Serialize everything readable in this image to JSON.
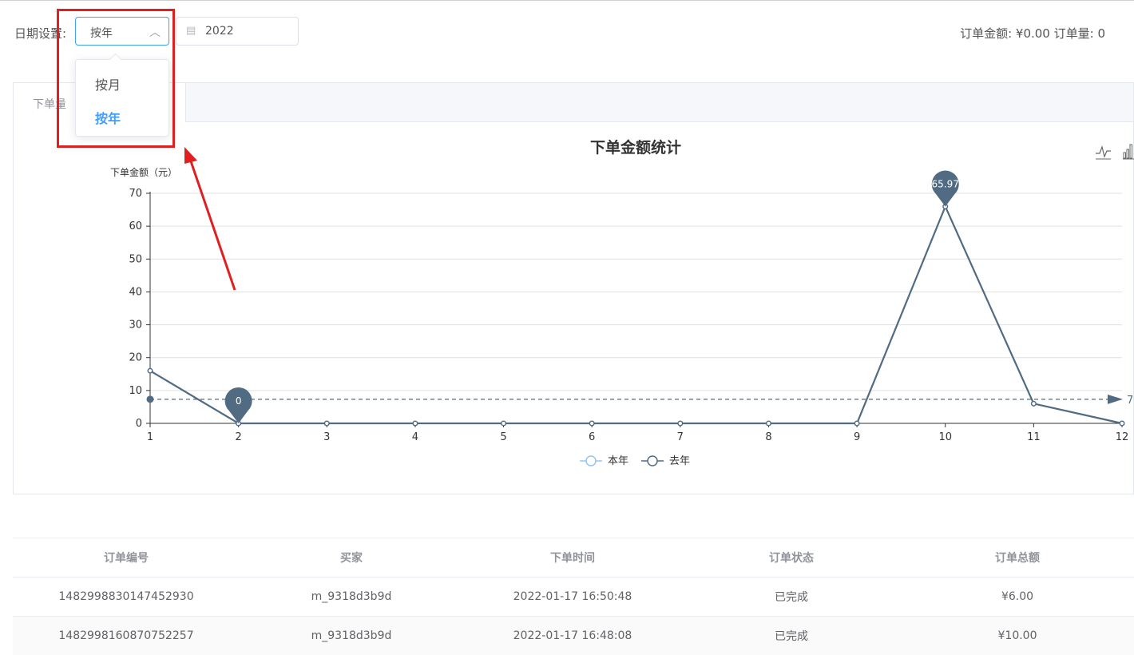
{
  "filter": {
    "label": "日期设置:",
    "mode_value": "按年",
    "year_value": "2022",
    "options": [
      "按月",
      "按年"
    ],
    "selected_option": "按年"
  },
  "summary": {
    "amount_text": "订单金额: ¥0.00",
    "count_text": "订单量: 0"
  },
  "tab_label": "下单量",
  "chart_data": {
    "type": "line",
    "title": "下单金额统计",
    "ylabel": "下单金额（元）",
    "xlabel": "",
    "x": [
      1,
      2,
      3,
      4,
      5,
      6,
      7,
      8,
      9,
      10,
      11,
      12
    ],
    "ylim": [
      0,
      70
    ],
    "yticks": [
      0,
      10,
      20,
      30,
      40,
      50,
      60,
      70
    ],
    "series": [
      {
        "name": "本年",
        "values": [
          16,
          0,
          0,
          0,
          0,
          0,
          0,
          0,
          0,
          65.97,
          6,
          0
        ]
      }
    ],
    "legend": [
      "本年",
      "去年"
    ],
    "legend_position": "bottom-center",
    "markers": [
      {
        "x": 2,
        "y": 0,
        "label": "0"
      },
      {
        "x": 10,
        "y": 65.97,
        "label": "65.97"
      }
    ],
    "average_line": {
      "value": 7.33,
      "label": "7"
    },
    "grid": true,
    "line_color": "#516b83"
  },
  "table": {
    "headers": [
      "订单编号",
      "买家",
      "下单时间",
      "订单状态",
      "订单总额"
    ],
    "rows": [
      [
        "1482998830147452930",
        "m_9318d3b9d",
        "2022-01-17 16:50:48",
        "已完成",
        "¥6.00"
      ],
      [
        "1482998160870752257",
        "m_9318d3b9d",
        "2022-01-17 16:48:08",
        "已完成",
        "¥10.00"
      ]
    ]
  }
}
